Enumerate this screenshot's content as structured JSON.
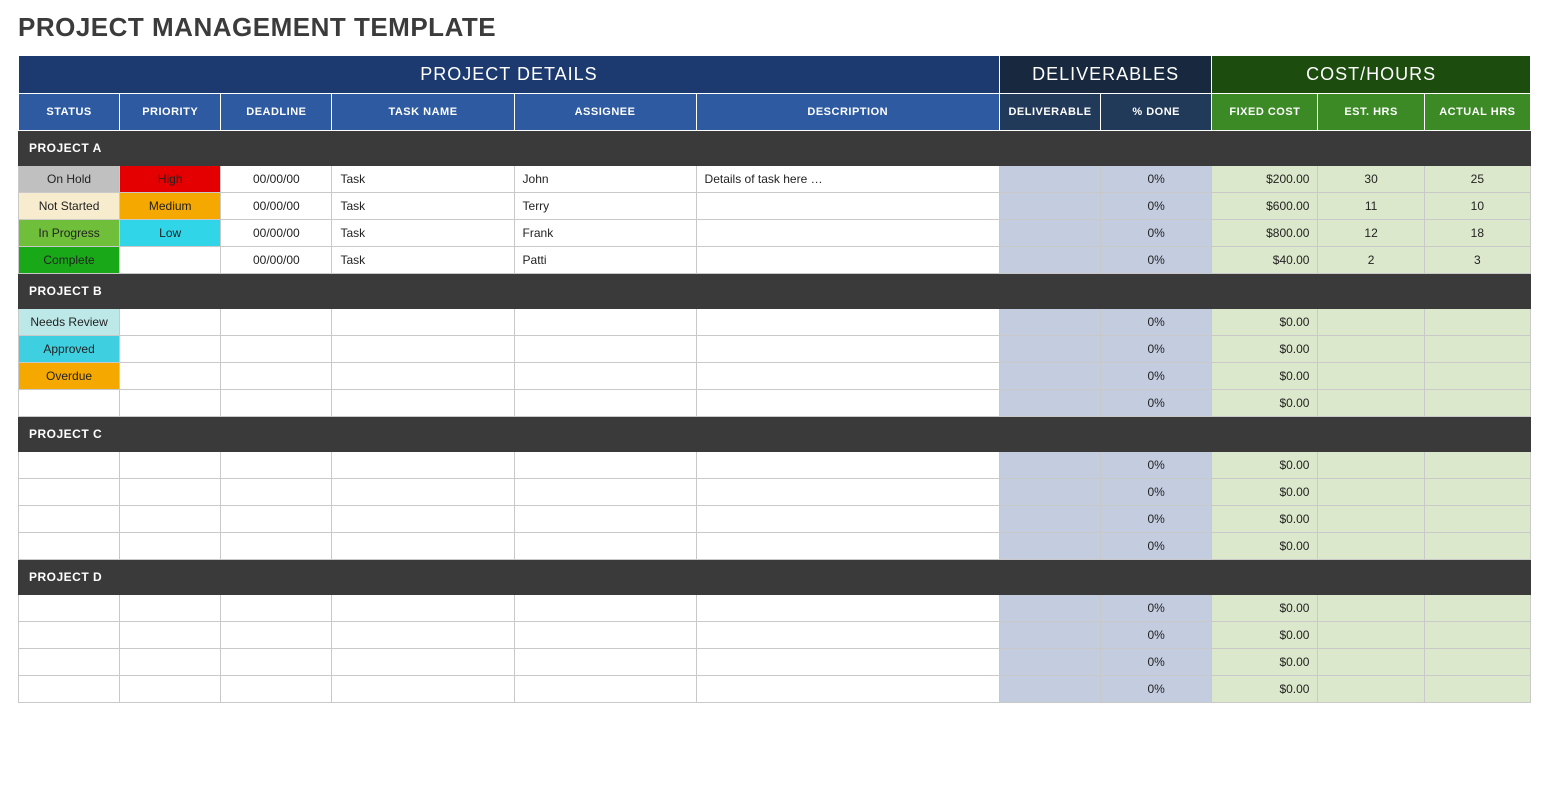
{
  "title": "PROJECT MANAGEMENT TEMPLATE",
  "groupHeaders": {
    "details": "PROJECT DETAILS",
    "deliverables": "DELIVERABLES",
    "costHours": "COST/HOURS"
  },
  "columns": {
    "status": "STATUS",
    "priority": "PRIORITY",
    "deadline": "DEADLINE",
    "taskName": "TASK NAME",
    "assignee": "ASSIGNEE",
    "description": "DESCRIPTION",
    "deliverable": "DELIVERABLE",
    "pctDone": "% DONE",
    "fixedCost": "FIXED COST",
    "estHrs": "EST. HRS",
    "actualHrs": "ACTUAL HRS"
  },
  "statusClasses": {
    "On Hold": "status-onhold",
    "Not Started": "status-notstarted",
    "In Progress": "status-inprogress",
    "Complete": "status-complete",
    "Needs Review": "status-needsreview",
    "Approved": "status-approved",
    "Overdue": "status-overdue"
  },
  "priorityClasses": {
    "High": "pri-high",
    "Medium": "pri-medium",
    "Low": "pri-low"
  },
  "projects": [
    {
      "name": "PROJECT A",
      "rows": [
        {
          "status": "On Hold",
          "priority": "High",
          "deadline": "00/00/00",
          "task": "Task",
          "assignee": "John",
          "description": "Details of task here …",
          "deliverable": "",
          "pctDone": "0%",
          "fixedCost": "$200.00",
          "estHrs": "30",
          "actualHrs": "25"
        },
        {
          "status": "Not Started",
          "priority": "Medium",
          "deadline": "00/00/00",
          "task": "Task",
          "assignee": "Terry",
          "description": "",
          "deliverable": "",
          "pctDone": "0%",
          "fixedCost": "$600.00",
          "estHrs": "11",
          "actualHrs": "10"
        },
        {
          "status": "In Progress",
          "priority": "Low",
          "deadline": "00/00/00",
          "task": "Task",
          "assignee": "Frank",
          "description": "",
          "deliverable": "",
          "pctDone": "0%",
          "fixedCost": "$800.00",
          "estHrs": "12",
          "actualHrs": "18"
        },
        {
          "status": "Complete",
          "priority": "",
          "deadline": "00/00/00",
          "task": "Task",
          "assignee": "Patti",
          "description": "",
          "deliverable": "",
          "pctDone": "0%",
          "fixedCost": "$40.00",
          "estHrs": "2",
          "actualHrs": "3"
        }
      ]
    },
    {
      "name": "PROJECT B",
      "rows": [
        {
          "status": "Needs Review",
          "priority": "",
          "deadline": "",
          "task": "",
          "assignee": "",
          "description": "",
          "deliverable": "",
          "pctDone": "0%",
          "fixedCost": "$0.00",
          "estHrs": "",
          "actualHrs": ""
        },
        {
          "status": "Approved",
          "priority": "",
          "deadline": "",
          "task": "",
          "assignee": "",
          "description": "",
          "deliverable": "",
          "pctDone": "0%",
          "fixedCost": "$0.00",
          "estHrs": "",
          "actualHrs": ""
        },
        {
          "status": "Overdue",
          "priority": "",
          "deadline": "",
          "task": "",
          "assignee": "",
          "description": "",
          "deliverable": "",
          "pctDone": "0%",
          "fixedCost": "$0.00",
          "estHrs": "",
          "actualHrs": ""
        },
        {
          "status": "",
          "priority": "",
          "deadline": "",
          "task": "",
          "assignee": "",
          "description": "",
          "deliverable": "",
          "pctDone": "0%",
          "fixedCost": "$0.00",
          "estHrs": "",
          "actualHrs": ""
        }
      ]
    },
    {
      "name": "PROJECT C",
      "rows": [
        {
          "status": "",
          "priority": "",
          "deadline": "",
          "task": "",
          "assignee": "",
          "description": "",
          "deliverable": "",
          "pctDone": "0%",
          "fixedCost": "$0.00",
          "estHrs": "",
          "actualHrs": ""
        },
        {
          "status": "",
          "priority": "",
          "deadline": "",
          "task": "",
          "assignee": "",
          "description": "",
          "deliverable": "",
          "pctDone": "0%",
          "fixedCost": "$0.00",
          "estHrs": "",
          "actualHrs": ""
        },
        {
          "status": "",
          "priority": "",
          "deadline": "",
          "task": "",
          "assignee": "",
          "description": "",
          "deliverable": "",
          "pctDone": "0%",
          "fixedCost": "$0.00",
          "estHrs": "",
          "actualHrs": ""
        },
        {
          "status": "",
          "priority": "",
          "deadline": "",
          "task": "",
          "assignee": "",
          "description": "",
          "deliverable": "",
          "pctDone": "0%",
          "fixedCost": "$0.00",
          "estHrs": "",
          "actualHrs": ""
        }
      ]
    },
    {
      "name": "PROJECT D",
      "rows": [
        {
          "status": "",
          "priority": "",
          "deadline": "",
          "task": "",
          "assignee": "",
          "description": "",
          "deliverable": "",
          "pctDone": "0%",
          "fixedCost": "$0.00",
          "estHrs": "",
          "actualHrs": ""
        },
        {
          "status": "",
          "priority": "",
          "deadline": "",
          "task": "",
          "assignee": "",
          "description": "",
          "deliverable": "",
          "pctDone": "0%",
          "fixedCost": "$0.00",
          "estHrs": "",
          "actualHrs": ""
        },
        {
          "status": "",
          "priority": "",
          "deadline": "",
          "task": "",
          "assignee": "",
          "description": "",
          "deliverable": "",
          "pctDone": "0%",
          "fixedCost": "$0.00",
          "estHrs": "",
          "actualHrs": ""
        },
        {
          "status": "",
          "priority": "",
          "deadline": "",
          "task": "",
          "assignee": "",
          "description": "",
          "deliverable": "",
          "pctDone": "0%",
          "fixedCost": "$0.00",
          "estHrs": "",
          "actualHrs": ""
        }
      ]
    }
  ]
}
